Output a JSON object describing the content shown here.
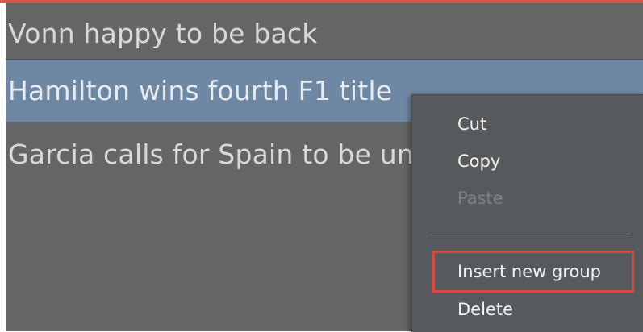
{
  "list": {
    "items": [
      {
        "label": "Vonn happy to be back",
        "selected": false
      },
      {
        "label": "Hamilton wins fourth F1 title",
        "selected": true
      },
      {
        "label": "Garcia calls for Spain to be united",
        "selected": false
      }
    ]
  },
  "context_menu": {
    "cut_label": "Cut",
    "copy_label": "Copy",
    "paste_label": "Paste",
    "paste_enabled": false,
    "insert_group_label": "Insert new group",
    "delete_label": "Delete",
    "highlighted_item": "Insert new group"
  },
  "colors": {
    "panel_bg": "#636566",
    "selected_row_bg": "#6e87a3",
    "menu_bg": "#575a5c",
    "highlight_border": "#e0473f",
    "top_accent": "#d9534f"
  }
}
